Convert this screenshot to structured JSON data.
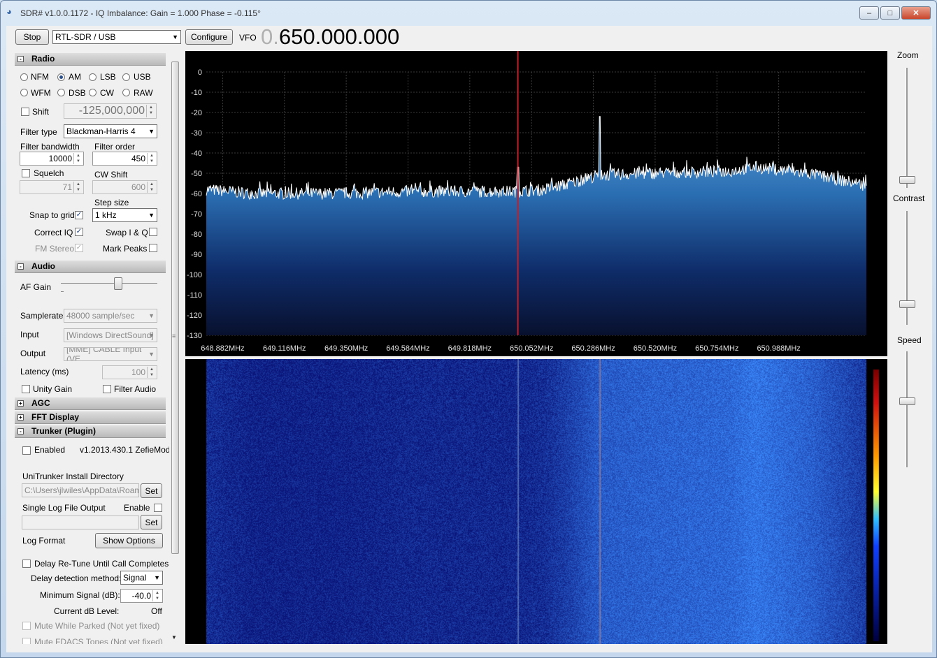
{
  "window": {
    "title": "SDR# v1.0.0.1172 - IQ Imbalance: Gain = 1.000 Phase = -0.115°"
  },
  "toolbar": {
    "stop_label": "Stop",
    "device": "RTL-SDR / USB",
    "configure_label": "Configure",
    "vfo_label": "VFO",
    "vfo_dim": "0.",
    "vfo_value": "650.000.000"
  },
  "radio": {
    "section": "Radio",
    "modes": [
      {
        "label": "NFM",
        "selected": false
      },
      {
        "label": "AM",
        "selected": true
      },
      {
        "label": "LSB",
        "selected": false
      },
      {
        "label": "USB",
        "selected": false
      },
      {
        "label": "WFM",
        "selected": false
      },
      {
        "label": "DSB",
        "selected": false
      },
      {
        "label": "CW",
        "selected": false
      },
      {
        "label": "RAW",
        "selected": false
      }
    ],
    "shift_label": "Shift",
    "shift_value": "-125,000,000",
    "filter_type_label": "Filter type",
    "filter_type": "Blackman-Harris 4",
    "filter_bandwidth_label": "Filter bandwidth",
    "filter_bandwidth": "10000",
    "filter_order_label": "Filter order",
    "filter_order": "450",
    "squelch_label": "Squelch",
    "squelch_value": "71",
    "cw_shift_label": "CW Shift",
    "cw_shift_value": "600",
    "step_size_label": "Step size",
    "step_size": "1 kHz",
    "snap_label": "Snap to grid",
    "correct_iq_label": "Correct IQ",
    "fm_stereo_label": "FM Stereo",
    "swap_iq_label": "Swap I & Q",
    "mark_peaks_label": "Mark Peaks"
  },
  "audio": {
    "section": "Audio",
    "af_gain_label": "AF Gain",
    "samplerate_label": "Samplerate",
    "samplerate": "48000 sample/sec",
    "input_label": "Input",
    "input": "[Windows DirectSound]",
    "output_label": "Output",
    "output": "[MME] CABLE Input (VE",
    "latency_label": "Latency (ms)",
    "latency": "100",
    "unity_gain_label": "Unity Gain",
    "filter_audio_label": "Filter Audio"
  },
  "agc": {
    "section": "AGC"
  },
  "fft": {
    "section": "FFT Display"
  },
  "trunker": {
    "section": "Trunker (Plugin)",
    "enabled_label": "Enabled",
    "version": "v1.2013.430.1 ZefieMod",
    "dir_label": "UniTrunker Install Directory",
    "dir_value": "C:\\Users\\jlwiles\\AppData\\Roamin",
    "set_label": "Set",
    "log_output_label": "Single Log File Output",
    "enable_label": "Enable",
    "log_format_label": "Log Format",
    "show_options_label": "Show Options",
    "delay_label": "Delay Re-Tune Until Call Completes",
    "detection_label": "Delay detection method:",
    "detection_value": "Signal",
    "min_signal_label": "Minimum Signal (dB):",
    "min_signal_value": "-40.0",
    "current_db_label": "Current dB Level:",
    "current_db_value": "Off",
    "mute_parked_label": "Mute While Parked (Not yet fixed)",
    "mute_fdacs_label": "Mute FDACS Tones (Not yet fixed)"
  },
  "right_panel": {
    "zoom_label": "Zoom",
    "contrast_label": "Contrast",
    "speed_label": "Speed",
    "zoom_level": 0.05,
    "contrast_level": 0.17,
    "speed_level": 0.58
  },
  "colors": {
    "spectrum_fill": "#2b6fb3",
    "vfo_line": "#c0202a",
    "waterfall_base": "#0a1a8a"
  },
  "chart_data": {
    "type": "area",
    "ylim": [
      -130,
      0
    ],
    "y_ticks": [
      "0",
      "-10",
      "-20",
      "-30",
      "-40",
      "-50",
      "-60",
      "-70",
      "-80",
      "-90",
      "-100",
      "-110",
      "-120",
      "-130"
    ],
    "x_ticks": [
      "648.882MHz",
      "649.116MHz",
      "649.350MHz",
      "649.584MHz",
      "649.818MHz",
      "650.052MHz",
      "650.286MHz",
      "650.520MHz",
      "650.754MHz",
      "650.988MHz"
    ],
    "series": [
      {
        "x_mhz": [
          648.82,
          649.0,
          649.3,
          649.6,
          649.9,
          650.0,
          650.1,
          650.2,
          650.3,
          650.5,
          650.8,
          650.9,
          651.1,
          651.32
        ],
        "y_db": [
          -58,
          -60,
          -60,
          -59,
          -59,
          -59,
          -58,
          -55,
          -51,
          -50,
          -49,
          -47,
          -50,
          -56
        ]
      }
    ],
    "peaks": [
      {
        "x_mhz": 650.31,
        "y_db": -22
      },
      {
        "x_mhz": 650.0,
        "y_db": -47
      }
    ],
    "vfo_mhz": 650.0
  }
}
